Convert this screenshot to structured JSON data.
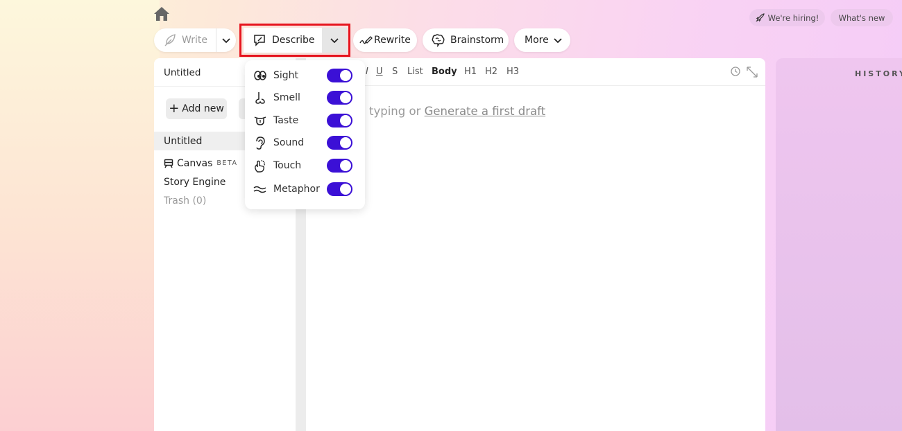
{
  "header": {
    "hiring_label": "We're hiring!",
    "whats_new_label": "What's new"
  },
  "toolbar": {
    "write_label": "Write",
    "describe_label": "Describe",
    "rewrite_label": "Rewrite",
    "brainstorm_label": "Brainstorm",
    "more_label": "More"
  },
  "sidebar": {
    "doc_title": "Untitled",
    "add_new_label": "Add new",
    "items": [
      {
        "label": "Untitled"
      },
      {
        "label": "Canvas",
        "badge": "BETA"
      },
      {
        "label": "Story Engine"
      },
      {
        "label": "Trash (0)"
      }
    ]
  },
  "editor": {
    "format_buttons": [
      "I",
      "U",
      "S",
      "List",
      "Body",
      "H1",
      "H2",
      "H3"
    ],
    "placeholder_prefix": "typing or",
    "placeholder_link": "Generate a first draft"
  },
  "history": {
    "title": "HISTORY"
  },
  "describe_menu": {
    "items": [
      {
        "label": "Sight",
        "enabled": true,
        "icon": "eyes-icon"
      },
      {
        "label": "Smell",
        "enabled": true,
        "icon": "nose-icon"
      },
      {
        "label": "Taste",
        "enabled": true,
        "icon": "tongue-icon"
      },
      {
        "label": "Sound",
        "enabled": true,
        "icon": "ear-icon"
      },
      {
        "label": "Touch",
        "enabled": true,
        "icon": "hand-icon"
      },
      {
        "label": "Metaphor",
        "enabled": true,
        "icon": "waves-icon"
      }
    ]
  },
  "colors": {
    "toggle_on": "#3b10d6",
    "highlight_outline": "#e6141e"
  }
}
